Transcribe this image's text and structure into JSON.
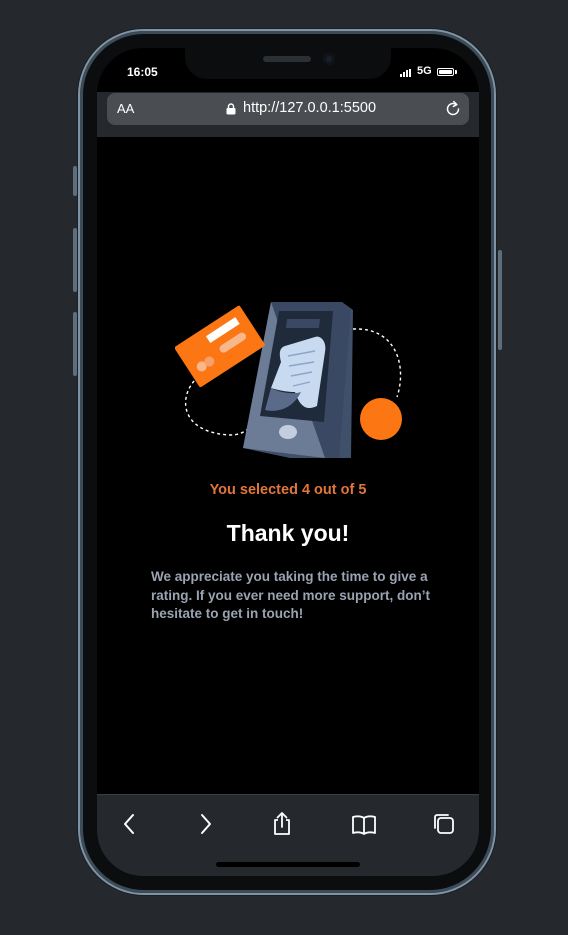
{
  "status_bar": {
    "time": "16:05",
    "network": "5G"
  },
  "browser": {
    "text_size_label": "AA",
    "url": "http://127.0.0.1:5500"
  },
  "rating": {
    "selected_text": "You selected 4 out of 5",
    "heading": "Thank you!",
    "message": "We appreciate you taking the time to give a rating. If you ever need more support, don’t hesitate to get in touch!"
  },
  "toolbar": {
    "buttons": [
      "back-icon",
      "forward-icon",
      "share-icon",
      "bookmarks-icon",
      "tabs-icon"
    ]
  },
  "colors": {
    "accent": "#FC7614",
    "background": "#000000",
    "text_muted": "#959EAC"
  }
}
